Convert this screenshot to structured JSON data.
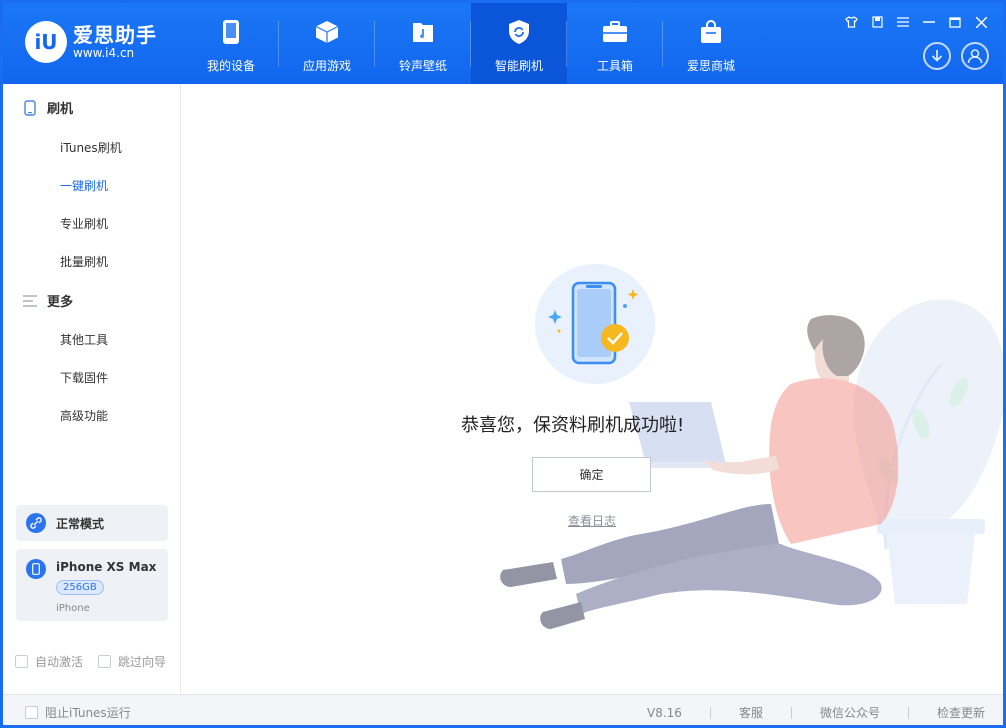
{
  "app": {
    "logo_mark": "iU",
    "logo_name": "爱思助手",
    "logo_url": "www.i4.cn"
  },
  "nav": {
    "items": [
      {
        "label": "我的设备",
        "icon": "phone-icon",
        "active": false
      },
      {
        "label": "应用游戏",
        "icon": "cube-icon",
        "active": false
      },
      {
        "label": "铃声壁纸",
        "icon": "music-folder-icon",
        "active": false
      },
      {
        "label": "智能刷机",
        "icon": "refresh-shield-icon",
        "active": true
      },
      {
        "label": "工具箱",
        "icon": "toolbox-icon",
        "active": false
      },
      {
        "label": "爱思商城",
        "icon": "shopping-bag-icon",
        "active": false
      }
    ]
  },
  "sidebar": {
    "flash_section": "刷机",
    "flash_items": [
      "iTunes刷机",
      "一键刷机",
      "专业刷机",
      "批量刷机"
    ],
    "active_item": "一键刷机",
    "more_section": "更多",
    "more_items": [
      "其他工具",
      "下载固件",
      "高级功能"
    ],
    "mode_label": "正常模式",
    "device": {
      "name": "iPhone XS Max",
      "capacity": "256GB",
      "type": "iPhone"
    },
    "auto_activate": "自动激活",
    "skip_guide": "跳过向导"
  },
  "main": {
    "success_message": "恭喜您，保资料刷机成功啦!",
    "confirm_button": "确定",
    "view_log": "查看日志"
  },
  "status_bar": {
    "block_itunes": "阻止iTunes运行",
    "version": "V8.16",
    "support": "客服",
    "wechat": "微信公众号",
    "check_update": "检查更新"
  },
  "colors": {
    "brand_blue": "#1a6cf0",
    "active_nav": "#0a55d8",
    "success_yellow": "#f5b81e"
  }
}
